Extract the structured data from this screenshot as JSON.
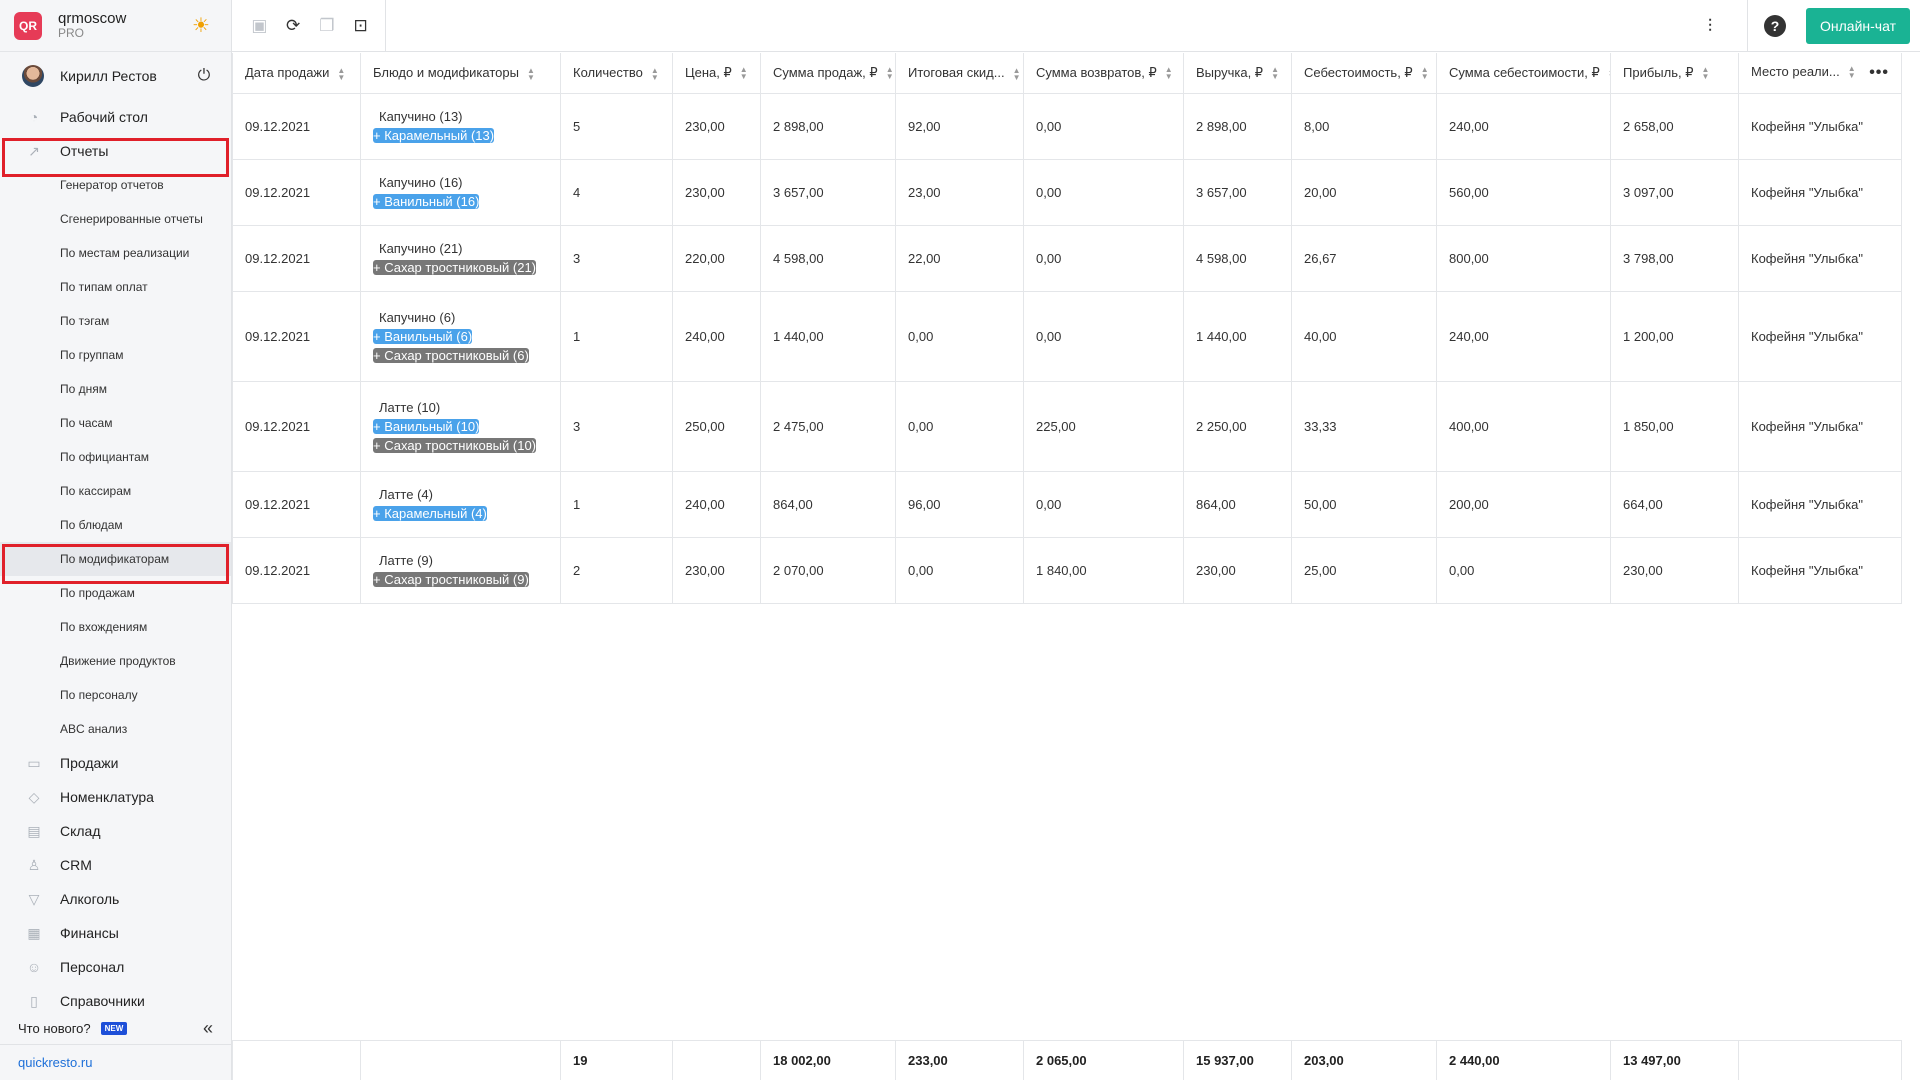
{
  "brand": {
    "logo_text": "QR",
    "name": "qrmoscow",
    "plan": "PRO"
  },
  "user": {
    "name": "Кирилл Рестов"
  },
  "nav": {
    "desktop": "Рабочий стол",
    "reports": "Отчеты",
    "report_items": [
      "Генератор отчетов",
      "Сгенерированные отчеты",
      "По местам реализации",
      "По типам оплат",
      "По тэгам",
      "По группам",
      "По дням",
      "По часам",
      "По официантам",
      "По кассирам",
      "По блюдам",
      "По модификаторам",
      "По продажам",
      "По вхождениям",
      "Движение продуктов",
      "По персоналу",
      "ABC анализ"
    ],
    "sections": [
      {
        "label": "Продажи",
        "icon": "basket-icon"
      },
      {
        "label": "Номенклатура",
        "icon": "tag-icon"
      },
      {
        "label": "Склад",
        "icon": "warehouse-icon"
      },
      {
        "label": "CRM",
        "icon": "people-icon"
      },
      {
        "label": "Алкоголь",
        "icon": "cocktail-icon"
      },
      {
        "label": "Финансы",
        "icon": "wallet-icon"
      },
      {
        "label": "Персонал",
        "icon": "staff-icon"
      },
      {
        "label": "Справочники",
        "icon": "book-icon"
      }
    ]
  },
  "footer": {
    "whats_new": "Что нового?",
    "new_badge": "NEW",
    "site": "quickresto.ru"
  },
  "toolbar": {
    "chat_label": "Онлайн-чат"
  },
  "columns": [
    "Дата продажи",
    "Блюдо и модификаторы",
    "Количество",
    "Цена, ₽",
    "Сумма продаж, ₽",
    "Итоговая скид...",
    "Сумма возвратов, ₽",
    "Выручка, ₽",
    "Себестоимость, ₽",
    "Сумма себестоимости, ₽",
    "Прибыль, ₽",
    "Место реали..."
  ],
  "rows": [
    {
      "date": "09.12.2021",
      "dish": "Капучино (13)",
      "mods": [
        {
          "label": "+ Карамельный (13)",
          "color": "blue"
        }
      ],
      "qty": "5",
      "price": "230,00",
      "sales": "2 898,00",
      "discount": "92,00",
      "returns": "0,00",
      "revenue": "2 898,00",
      "cost": "8,00",
      "cost_sum": "240,00",
      "profit": "2 658,00",
      "place": "Кофейня \"Улыбка\""
    },
    {
      "date": "09.12.2021",
      "dish": "Капучино (16)",
      "mods": [
        {
          "label": "+ Ванильный (16)",
          "color": "blue"
        }
      ],
      "qty": "4",
      "price": "230,00",
      "sales": "3 657,00",
      "discount": "23,00",
      "returns": "0,00",
      "revenue": "3 657,00",
      "cost": "20,00",
      "cost_sum": "560,00",
      "profit": "3 097,00",
      "place": "Кофейня \"Улыбка\""
    },
    {
      "date": "09.12.2021",
      "dish": "Капучино (21)",
      "mods": [
        {
          "label": "+ Сахар тростниковый (21)",
          "color": "gray"
        }
      ],
      "qty": "3",
      "price": "220,00",
      "sales": "4 598,00",
      "discount": "22,00",
      "returns": "0,00",
      "revenue": "4 598,00",
      "cost": "26,67",
      "cost_sum": "800,00",
      "profit": "3 798,00",
      "place": "Кофейня \"Улыбка\""
    },
    {
      "date": "09.12.2021",
      "dish": "Капучино (6)",
      "mods": [
        {
          "label": "+ Ванильный (6)",
          "color": "blue"
        },
        {
          "label": "+ Сахар тростниковый (6)",
          "color": "gray"
        }
      ],
      "qty": "1",
      "price": "240,00",
      "sales": "1 440,00",
      "discount": "0,00",
      "returns": "0,00",
      "revenue": "1 440,00",
      "cost": "40,00",
      "cost_sum": "240,00",
      "profit": "1 200,00",
      "place": "Кофейня \"Улыбка\""
    },
    {
      "date": "09.12.2021",
      "dish": "Латте (10)",
      "mods": [
        {
          "label": "+ Ванильный (10)",
          "color": "blue"
        },
        {
          "label": "+ Сахар тростниковый (10)",
          "color": "gray"
        }
      ],
      "qty": "3",
      "price": "250,00",
      "sales": "2 475,00",
      "discount": "0,00",
      "returns": "225,00",
      "revenue": "2 250,00",
      "cost": "33,33",
      "cost_sum": "400,00",
      "profit": "1 850,00",
      "place": "Кофейня \"Улыбка\""
    },
    {
      "date": "09.12.2021",
      "dish": "Латте (4)",
      "mods": [
        {
          "label": "+ Карамельный (4)",
          "color": "blue"
        }
      ],
      "qty": "1",
      "price": "240,00",
      "sales": "864,00",
      "discount": "96,00",
      "returns": "0,00",
      "revenue": "864,00",
      "cost": "50,00",
      "cost_sum": "200,00",
      "profit": "664,00",
      "place": "Кофейня \"Улыбка\""
    },
    {
      "date": "09.12.2021",
      "dish": "Латте (9)",
      "mods": [
        {
          "label": "+ Сахар тростниковый (9)",
          "color": "gray"
        }
      ],
      "qty": "2",
      "price": "230,00",
      "sales": "2 070,00",
      "discount": "0,00",
      "returns": "1 840,00",
      "revenue": "230,00",
      "cost": "25,00",
      "cost_sum": "0,00",
      "profit": "230,00",
      "place": "Кофейня \"Улыбка\""
    }
  ],
  "totals": {
    "qty": "19",
    "sales": "18 002,00",
    "discount": "233,00",
    "returns": "2 065,00",
    "revenue": "15 937,00",
    "cost": "203,00",
    "cost_sum": "2 440,00",
    "profit": "13 497,00"
  },
  "colors": {
    "accent_green": "#1ab394",
    "modifier_blue": "#4aa2ea",
    "modifier_gray": "#777777",
    "highlight_red": "#e0202a",
    "brand_red": "#e63b57"
  }
}
